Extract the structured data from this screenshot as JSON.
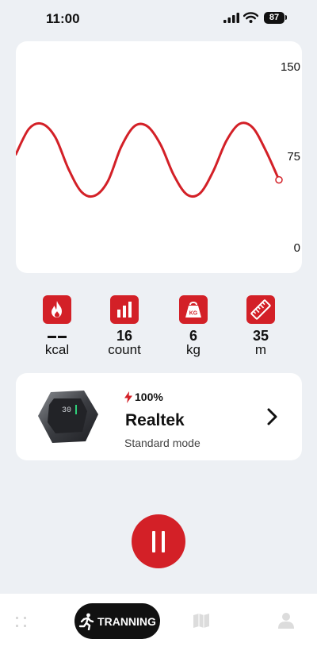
{
  "status_bar": {
    "time": "11:00",
    "battery": "87"
  },
  "chart_data": {
    "type": "line",
    "title": "",
    "xlabel": "",
    "ylabel": "",
    "ylim": [
      0,
      150
    ],
    "yticks": [
      "150",
      "75",
      "0"
    ],
    "color": "#d32027",
    "series": [
      {
        "values": [
          78,
          99,
          103,
          92,
          66,
          47,
          44,
          56,
          84,
          101,
          101,
          86,
          61,
          45,
          46,
          64,
          89,
          103,
          100,
          81,
          57
        ]
      }
    ]
  },
  "stats": [
    {
      "icon": "flame-icon",
      "value": "",
      "unit": "kcal"
    },
    {
      "icon": "bar-chart-icon",
      "value": "16",
      "unit": "count"
    },
    {
      "icon": "kettlebell-kg-icon",
      "value": "6",
      "unit": "kg"
    },
    {
      "icon": "ruler-icon",
      "value": "35",
      "unit": "m"
    }
  ],
  "device": {
    "battery": "100%",
    "name": "Realtek",
    "mode": "Standard mode",
    "display_digits": "30"
  },
  "tabbar": {
    "active_label": "TRANNING"
  },
  "colors": {
    "accent": "#d32027",
    "background": "#edf0f4"
  }
}
